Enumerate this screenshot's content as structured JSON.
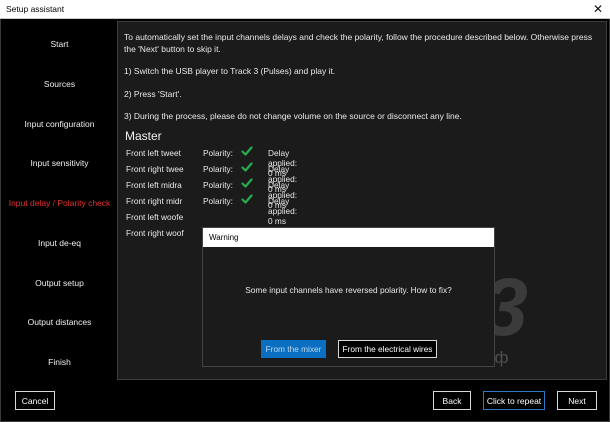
{
  "window": {
    "title": "Setup assistant",
    "close_glyph": "✕"
  },
  "sidebar": {
    "items": [
      {
        "label": "Start",
        "active": false
      },
      {
        "label": "Sources",
        "active": false
      },
      {
        "label": "Input configuration",
        "active": false
      },
      {
        "label": "Input sensitivity",
        "active": false
      },
      {
        "label": "Input delay / Polarity check",
        "active": true
      },
      {
        "label": "Input de-eq",
        "active": false
      },
      {
        "label": "Output setup",
        "active": false
      },
      {
        "label": "Output distances",
        "active": false
      },
      {
        "label": "Finish",
        "active": false
      }
    ]
  },
  "main": {
    "intro": "To automatically set the input channels delays and check the polarity, follow the procedure described below. Otherwise press the 'Next' button to skip it.",
    "step1": "1) Switch the USB player to Track 3 (Pulses) and play it.",
    "step2": "2) Press 'Start'.",
    "step3": "3) During the process, please do not change volume on the source or disconnect any line.",
    "section_title": "Master",
    "channels": [
      {
        "name": "Front left tweet",
        "polarity_label": "Polarity:",
        "ok": true,
        "delay": "Delay applied: 0 ms"
      },
      {
        "name": "Front right twee",
        "polarity_label": "Polarity:",
        "ok": true,
        "delay": "Delay applied: 0 ms"
      },
      {
        "name": "Front left midra",
        "polarity_label": "Polarity:",
        "ok": true,
        "delay": "Delay applied: 0 ms"
      },
      {
        "name": "Front right midr",
        "polarity_label": "Polarity:",
        "ok": true,
        "delay": "Delay applied: 0 ms"
      },
      {
        "name": "Front left woofe"
      },
      {
        "name": "Front right woof"
      }
    ]
  },
  "dialog": {
    "title": "Warning",
    "message": "Some input channels have reversed polarity. How to fix?",
    "primary_label": "From the mixer",
    "secondary_label": "From the electrical wires"
  },
  "watermark": {
    "logo": "A3",
    "site": "автозвук.рф"
  },
  "footer": {
    "cancel_label": "Cancel",
    "back_label": "Back",
    "repeat_label": "Click to repeat",
    "next_label": "Next"
  },
  "colors": {
    "active_step": "#e53030",
    "check": "#2fa84f",
    "primary_button": "#0a6fc0",
    "repeat_border": "#2b79c8"
  },
  "icons": {
    "polarity_ok": "check-icon",
    "close": "close-icon"
  }
}
